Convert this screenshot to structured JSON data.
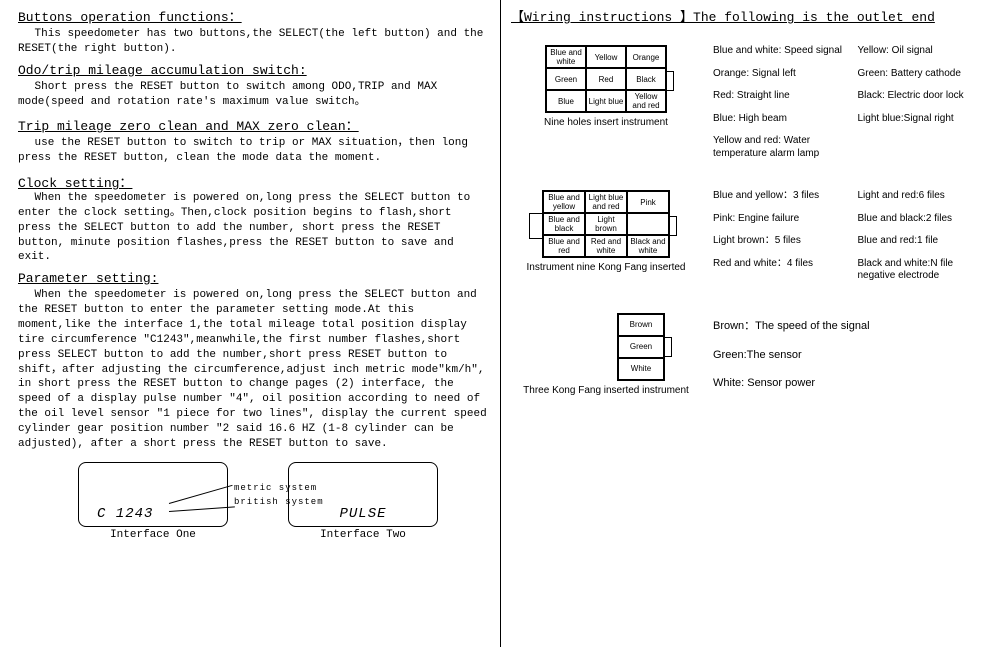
{
  "left": {
    "h_buttons": "Buttons operation functions：",
    "p_buttons": "This speedometer has two buttons,the SELECT(the left button) and the RESET(the right button).",
    "h_odo": "Odo/trip mileage accumulation switch:",
    "p_odo": "Short press the RESET button to switch among ODO,TRIP and MAX mode(speed and rotation rate's maximum value switch。",
    "h_tripzero": "Trip mileage zero clean and MAX zero clean：",
    "p_tripzero": "use the RESET button to switch to trip or MAX situation，then long press the RESET button, clean the mode data the moment.",
    "h_clock": "Clock setting：",
    "p_clock": "When the speedometer is powered on,long press the SELECT button to enter the clock setting。Then,clock position begins to flash,short press the SELECT button to add the number, short press the RESET button, minute position flashes,press the RESET button to save and exit.",
    "h_param": "Parameter setting:",
    "p_param": "When the speedometer is powered on,long press the SELECT button and the RESET button to enter the parameter setting mode.At this moment,like the interface 1,the total mileage total position display tire circumference \"C1243\",meanwhile,the first number flashes,short press SELECT button to add the number,short press RESET button to shift，after adjusting the circumference,adjust inch metric mode\"km/h\", in short press the RESET button to change pages (2) interface, the speed of a display pulse number \"4\", oil position according to need of the oil level sensor \"1 piece for two lines\", display the current speed cylinder gear position number \"2 said 16.6 HZ (1-8 cylinder can be adjusted), after a short press the RESET button to save.",
    "iface1_text": "C 1243",
    "iface1_cap": "Interface One",
    "iface2_text": "PULSE",
    "iface2_cap": "Interface Two",
    "metric1": "metric system",
    "metric2": "british system"
  },
  "right": {
    "h_wiring": "【Wiring instructions 】The following is the outlet end",
    "nine1_cells": [
      "Blue and white",
      "Yellow",
      "Orange",
      "Green",
      "Red",
      "Black",
      "Blue",
      "Light blue",
      "Yellow and red"
    ],
    "nine1_caption": "Nine holes insert instrument",
    "nine1_legend": [
      "Blue and white: Speed signal",
      "Yellow: Oil signal",
      "Orange: Signal left",
      "Green: Battery cathode",
      "Red: Straight line",
      "Black: Electric door lock",
      "Blue: High beam",
      "Light blue:Signal right",
      "Yellow and red: Water temperature alarm lamp",
      ""
    ],
    "nine2_cells": [
      "Blue and yellow",
      "Light blue and red",
      "Pink",
      "Blue and black",
      "Light brown",
      "",
      "Blue and red",
      "Red and white",
      "Black and white"
    ],
    "nine2_caption": "Instrument nine Kong Fang inserted",
    "nine2_legend": [
      "Blue and yellow：3 files",
      "Light and red:6 files",
      "Pink: Engine failure",
      "Blue and black:2 files",
      "Light brown：5 files",
      "Blue and red:1 file",
      "Red and white：4 files",
      "Black and white:N file negative electrode"
    ],
    "three_cells": [
      "Brown",
      "Green",
      "White"
    ],
    "three_caption": "Three Kong Fang inserted instrument",
    "three_legend": [
      "Brown：The speed of the signal",
      "Green:The sensor",
      "White: Sensor power"
    ]
  }
}
